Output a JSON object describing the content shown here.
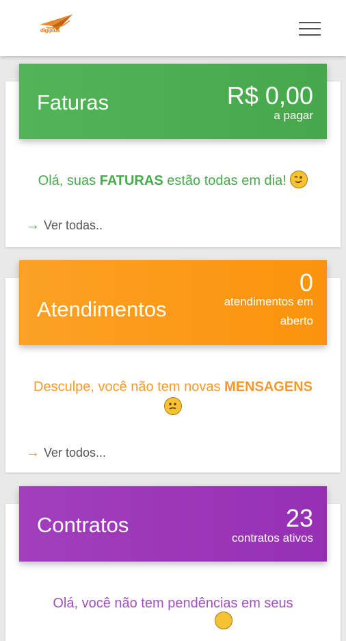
{
  "topbar": {
    "logo_text": "digiplus",
    "logo_icon": "paper-plane-logo",
    "menu_icon": "hamburger-menu-icon"
  },
  "colors": {
    "invoices": "#4cae50",
    "tickets": "#fb9a12",
    "contracts": "#9b35b8"
  },
  "invoices": {
    "title": "Faturas",
    "value": "R$ 0,00",
    "value_caption": "a pagar",
    "message_prefix": "Olá, suas ",
    "message_bold": "FATURAS",
    "message_suffix": " estão todas em dia!",
    "emoji": "winking-face-icon",
    "link_label": "Ver todas.."
  },
  "tickets": {
    "title": "Atendimentos",
    "value": "0",
    "value_caption_line1": "atendimentos em",
    "value_caption_line2": "aberto",
    "message_prefix": "Desculpe, você não tem novas ",
    "message_bold": "MENSAGENS",
    "emoji": "confused-face-icon",
    "link_label": "Ver todos..."
  },
  "contracts": {
    "title": "Contratos",
    "value": "23",
    "value_caption": "contratos ativos",
    "message": "Olá, você não tem pendências em seus"
  }
}
